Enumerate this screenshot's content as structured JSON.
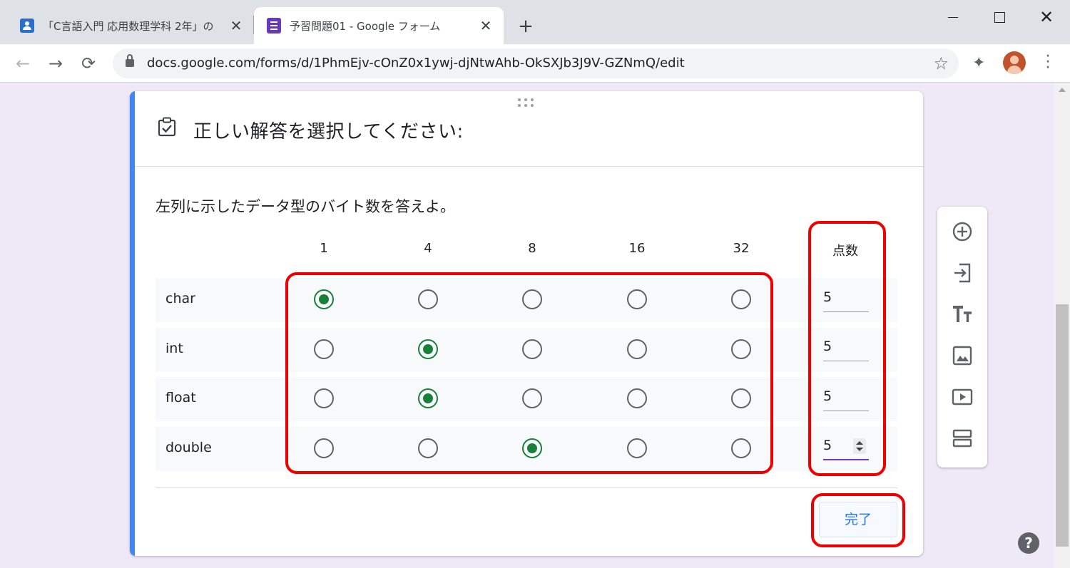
{
  "browser": {
    "tabs": [
      {
        "title": "「C言語入門 応用数理学科 2年」の",
        "icon": "classroom-icon",
        "active": false
      },
      {
        "title": "予習問題01 - Google フォーム",
        "icon": "forms-icon",
        "active": true
      }
    ],
    "new_tab_label": "+",
    "address": "docs.google.com/forms/d/1PhmEjv-cOnZ0x1ywj-djNtwAhb-OkSXJb3J9V-GZNmQ/edit"
  },
  "card": {
    "answer_title": "正しい解答を選択してください:",
    "question": "左列に示したデータ型のバイト数を答えよ。",
    "columns": [
      "1",
      "4",
      "8",
      "16",
      "32"
    ],
    "score_header": "点数",
    "rows": [
      {
        "label": "char",
        "selected": 0,
        "points": "5"
      },
      {
        "label": "int",
        "selected": 1,
        "points": "5"
      },
      {
        "label": "float",
        "selected": 1,
        "points": "5"
      },
      {
        "label": "double",
        "selected": 2,
        "points": "5"
      }
    ],
    "done_label": "完了"
  },
  "side_toolbar": [
    "add-question-icon",
    "import-questions-icon",
    "add-title-icon",
    "add-image-icon",
    "add-video-icon",
    "add-section-icon"
  ],
  "help_label": "?",
  "colors": {
    "accent": "#4285f4",
    "selected_radio": "#188038",
    "highlight": "#ee0000",
    "focus": "#673ab7",
    "page_bg": "#efe8f6"
  }
}
